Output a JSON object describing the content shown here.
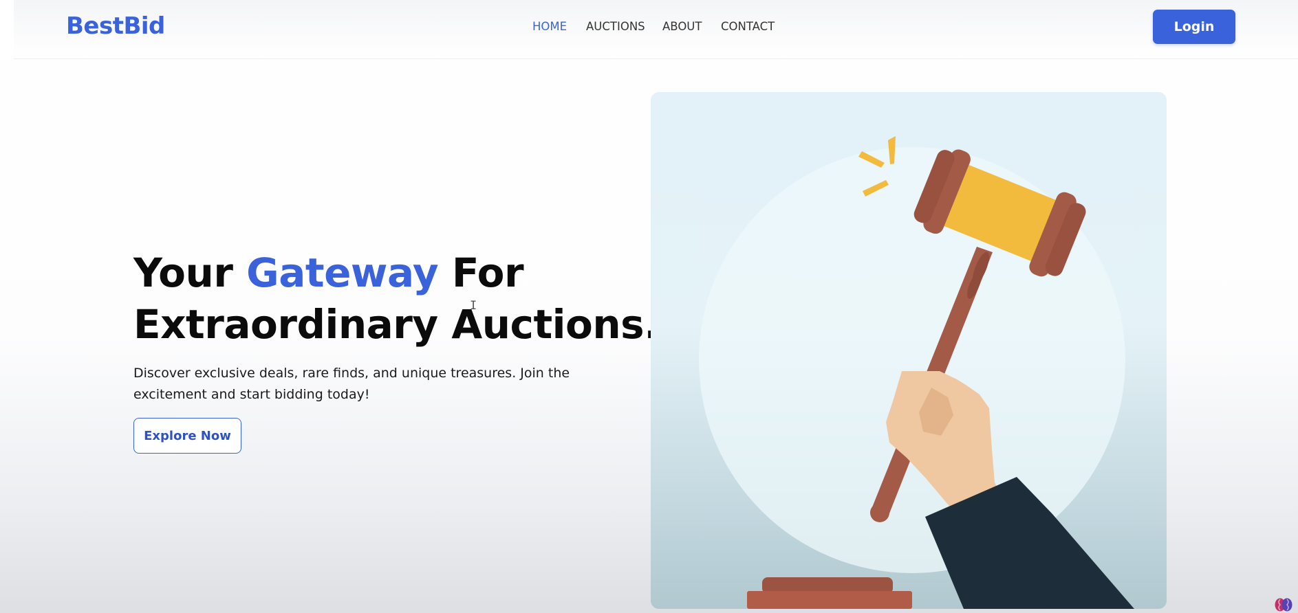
{
  "header": {
    "brand": "BestBid",
    "nav": [
      {
        "label": "HOME",
        "active": true
      },
      {
        "label": "AUCTIONS",
        "active": false
      },
      {
        "label": "ABOUT",
        "active": false
      },
      {
        "label": "CONTACT",
        "active": false
      }
    ],
    "login_label": "Login"
  },
  "hero": {
    "title_part1": "Your ",
    "title_accent": "Gateway",
    "title_part2": " For",
    "title_line2": "Extraordinary Auctions.",
    "description": "Discover exclusive deals, rare finds, and unique treasures. Join the excitement and start bidding today!",
    "cta_label": "Explore Now",
    "image_icon": "auction-gavel-illustration"
  },
  "colors": {
    "accent": "#3a63db",
    "text": "#0b0b0b",
    "gavel_brown": "#a35a46",
    "gavel_gold": "#f2bb3e",
    "sleeve": "#1d2e3a",
    "skin": "#efc7a0"
  },
  "overlay_icon": "brain-icon"
}
